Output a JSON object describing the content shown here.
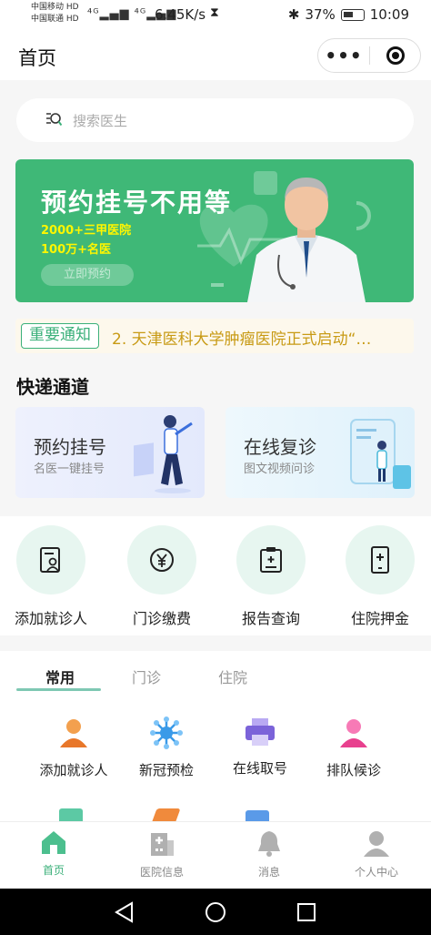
{
  "status_bar": {
    "carrier1": "中国移动",
    "carrier2": "中国联通",
    "hd1": "HD",
    "hd2": "HD",
    "signal": "⁴ᴳ▂▄▆ ⁴ᴳ▂▄▆",
    "speed": "6.45K/s",
    "hourglass": "⧗",
    "bluetooth": "✱",
    "battery": "37%",
    "time": "10:09"
  },
  "nav": {
    "title": "首页",
    "more": "•••"
  },
  "search": {
    "placeholder": "搜索医生"
  },
  "banner": {
    "title": "预约挂号不用等",
    "line1": "2000+三甲医院",
    "line2": "100万+名医",
    "button": "立即预约"
  },
  "notice": {
    "tag": "重要通知",
    "text": "2. 天津医科大学肿瘤医院正式启动“…"
  },
  "quick_section": {
    "title": "快递通道",
    "cards": [
      {
        "title": "预约挂号",
        "subtitle": "名医一键挂号"
      },
      {
        "title": "在线复诊",
        "subtitle": "图文视频问诊"
      }
    ]
  },
  "shortcuts": [
    {
      "label": "添加就诊人",
      "icon": "patient-card-icon"
    },
    {
      "label": "门诊缴费",
      "icon": "yuan-coin-icon"
    },
    {
      "label": "报告查询",
      "icon": "report-clipboard-icon"
    },
    {
      "label": "住院押金",
      "icon": "deposit-phone-icon"
    }
  ],
  "tabs": [
    "常用",
    "门诊",
    "住院"
  ],
  "services": [
    {
      "label": "添加就诊人",
      "icon": "person-add-icon",
      "color": "#f08a3c"
    },
    {
      "label": "新冠预检",
      "icon": "virus-icon",
      "color": "#3a9ae8"
    },
    {
      "label": "在线取号",
      "icon": "printer-icon",
      "color": "#7b63d9"
    },
    {
      "label": "排队候诊",
      "icon": "person-queue-icon",
      "color": "#f0509e"
    }
  ],
  "tabbar": [
    {
      "label": "首页",
      "icon": "home-icon",
      "active": true
    },
    {
      "label": "医院信息",
      "icon": "hospital-icon",
      "active": false
    },
    {
      "label": "消息",
      "icon": "bell-icon",
      "active": false
    },
    {
      "label": "个人中心",
      "icon": "user-icon",
      "active": false
    }
  ],
  "colors": {
    "primary": "#3bb07a",
    "banner": "#3fb877",
    "notice_text": "#c89a14"
  }
}
